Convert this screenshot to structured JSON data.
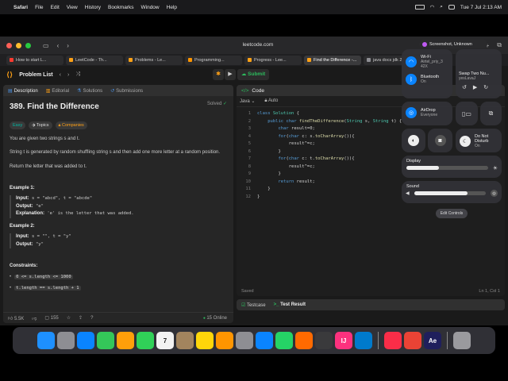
{
  "menubar": {
    "app": "Safari",
    "items": [
      "File",
      "Edit",
      "View",
      "History",
      "Bookmarks",
      "Window",
      "Help"
    ],
    "clock": "Tue 7 Jul  2:13 AM"
  },
  "browser": {
    "url": "leetcode.com",
    "tabs": [
      {
        "title": "How to start L...",
        "color": "#ff3b30"
      },
      {
        "title": "LeetCode - Th...",
        "color": "#ffa116"
      },
      {
        "title": "Problems - Le...",
        "color": "#ffa116"
      },
      {
        "title": "Programming...",
        "color": "#ff9500"
      },
      {
        "title": "Progress - Lee...",
        "color": "#ffa116"
      },
      {
        "title": "Find the Difference -...",
        "color": "#ffa116"
      },
      {
        "title": "java docs jdk 2...",
        "color": "#8e8e93"
      }
    ]
  },
  "leetcode": {
    "problem_list": "Problem List",
    "submit": "Submit",
    "tabs": [
      "Description",
      "Editorial",
      "Solutions",
      "Submissions"
    ],
    "title": "389. Find the Difference",
    "status": "Solved",
    "difficulty": "Easy",
    "topics": "Topics",
    "companies": "Companies",
    "desc1": "You are given two strings s and t.",
    "desc2": "String t is generated by random shuffling string s and then add one more letter at a random position.",
    "desc3": "Return the letter that was added to t.",
    "example1": {
      "heading": "Example 1:",
      "input_label": "Input:",
      "input": "s = \"abcd\", t = \"abcde\"",
      "output_label": "Output:",
      "output": "\"e\"",
      "explanation_label": "Explanation:",
      "explanation": "'e' is the letter that was added."
    },
    "example2": {
      "heading": "Example 2:",
      "input_label": "Input:",
      "input": "s = \"\", t = \"y\"",
      "output_label": "Output:",
      "output": "\"y\""
    },
    "constraints_heading": "Constraints:",
    "constraints": [
      "0 <= s.length <= 1000",
      "t.length == s.length + 1"
    ],
    "likes": "5.5K",
    "comments": "155",
    "online": "15 Online",
    "code_header": "Code",
    "language": "Java",
    "auto": "Auto",
    "code_lines": [
      "class Solution {",
      "    public char findTheDifference(String s, String t) {",
      "        char result=0;",
      "        for(char c: s.toCharArray()){",
      "            result^=c;",
      "        }",
      "        for(char c: t.toCharArray()){",
      "            result^=c;",
      "        }",
      "        return result;",
      "    }",
      "}"
    ],
    "saved": "Saved",
    "cursor": "Ln 1, Col 1",
    "testcase": "Testcase",
    "test_result": "Test Result"
  },
  "control_center": {
    "screenshot_pill": "Screenshot, Unknown",
    "wifi_label": "Wi-Fi",
    "wifi_network": "Airtel_priy_3",
    "wifi_sub": "42X",
    "bluetooth_label": "Bluetooth",
    "bluetooth_state": "On",
    "airdrop_label": "AirDrop",
    "airdrop_state": "Everyone",
    "now_playing": "Swap Two Nu...",
    "now_playing_sub": "yesLavaJ",
    "dnd_label": "Do Not Disturb",
    "dnd_state": "On",
    "display_label": "Display",
    "display_level": 0.4,
    "sound_label": "Sound",
    "sound_level": 0.75,
    "edit_controls": "Edit Controls"
  },
  "dock_apps": [
    {
      "name": "finder",
      "color": "#1e90ff"
    },
    {
      "name": "launchpad",
      "color": "#8e8e93"
    },
    {
      "name": "safari",
      "color": "#0a84ff"
    },
    {
      "name": "maps",
      "color": "#34c759"
    },
    {
      "name": "photos",
      "color": "#ff9f0a"
    },
    {
      "name": "facetime",
      "color": "#30d158"
    },
    {
      "name": "calendar",
      "color": "#f2f2f2"
    },
    {
      "name": "contacts",
      "color": "#a2845e"
    },
    {
      "name": "notes",
      "color": "#ffd60a"
    },
    {
      "name": "pages",
      "color": "#ff9500"
    },
    {
      "name": "settings",
      "color": "#8e8e93"
    },
    {
      "name": "appstore",
      "color": "#0a84ff"
    },
    {
      "name": "whatsapp",
      "color": "#25d366"
    },
    {
      "name": "screenshot",
      "color": "#ff6a00"
    },
    {
      "name": "davinci",
      "color": "#3a3a3c"
    },
    {
      "name": "intellij",
      "color": "#fc317e"
    },
    {
      "name": "vscode",
      "color": "#007acc"
    },
    {
      "name": "music",
      "color": "#fa2d48"
    },
    {
      "name": "chrome",
      "color": "#ea4335"
    },
    {
      "name": "aftereffects",
      "color": "#1f1f5c"
    },
    {
      "name": "trash",
      "color": "#9a9a9e"
    }
  ],
  "dock_labels": {
    "calendar": "7",
    "aftereffects": "Ae",
    "intellij": "IJ"
  }
}
